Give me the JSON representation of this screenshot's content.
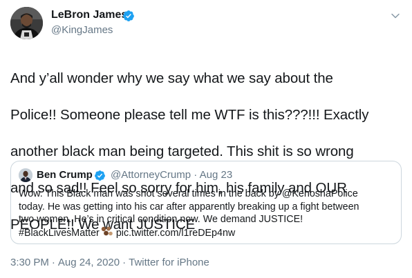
{
  "colors": {
    "text": "#14171a",
    "secondary": "#657786",
    "verified": "#1da1f2",
    "border": "#ccd6dd"
  },
  "tweet": {
    "author_name": "LeBron James",
    "author_handle": "@KingJames",
    "text_lines": [
      "And y’all wonder why we say what we say about the",
      "Police!! Someone please tell me WTF is this???!!! Exactly",
      "another black man being targeted. This shit is so wrong",
      "and so sad!! Feel so sorry for him, his family and OUR",
      "PEOPLE!! We want JUSTICE"
    ],
    "time": "3:30 PM",
    "date": "Aug 24, 2020",
    "separator": "·",
    "source": "Twitter for iPhone"
  },
  "quoted_tweet": {
    "author_name": "Ben Crump",
    "author_handle": "@AttorneyCrump",
    "separator": "·",
    "date": "Aug 23",
    "text_lines": [
      "Wow. This Black man was shot several times in the back by @KenoshaPolice",
      "today. He was getting into his car after apparently breaking up a fight between",
      "two women. He’s in critical condition now. We demand JUSTICE!"
    ],
    "hashtag": "#BlackLivesMatter",
    "emoji_name": "brown-hands-emoji",
    "link": "pic.twitter.com/l1reDEp4nw"
  },
  "icons": {
    "verified": "verified-badge-icon",
    "menu": "chevron-down-icon"
  }
}
